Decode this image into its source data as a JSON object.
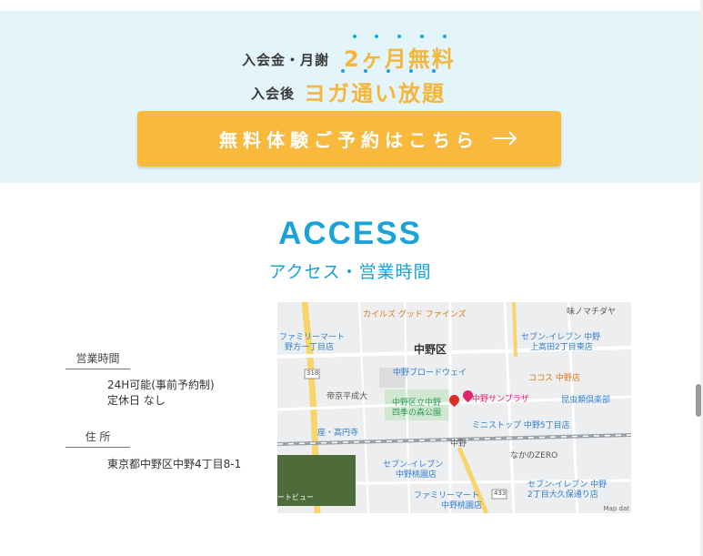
{
  "promo": {
    "line1_prefix": "入会金・月謝",
    "line1_highlight": "2ヶ月無料",
    "line2_prefix": "入会後",
    "line2_highlight": "ヨガ通い放題",
    "cta_label": "無料体験ご予約はこちら",
    "cta_arrow": "arrow-right-icon"
  },
  "access": {
    "title": "ACCESS",
    "subtitle": "アクセス・営業時間"
  },
  "info": {
    "hours_heading": "営業時間",
    "hours_line1": "24H可能(事前予約制)",
    "hours_line2": "定休日 なし",
    "address_heading": "住 所",
    "address": "東京都中野区中野4丁目8-1"
  },
  "map": {
    "labels": {
      "guitar": "カイルズ グッド ファインズ",
      "ajinomachi": "味ノマチダヤ",
      "familymart1_a": "ファミリーマート",
      "familymart1_b": "野方一丁目店",
      "seven1_a": "セブン-イレブン 中野",
      "seven1_b": "上高田2丁目東店",
      "nakano_ku": "中野区",
      "broadway": "中野ブロードウェイ",
      "cocos": "ココス 中野店",
      "teikyo": "帝京平成大",
      "park_a": "中野区立中野",
      "park_b": "四季の森公園",
      "sunplaza": "中野サンプラザ",
      "kochu": "昆虫類倶楽部",
      "koenji": "座・高円寺",
      "ministop": "ミニストップ 中野5丁目店",
      "nakano_zero": "なかのZERO",
      "nakano_station": "中野",
      "seven2_a": "セブン-イレブン",
      "seven2_b": "中野桃園店",
      "seven3_a": "セブン-イレブン 中野",
      "seven3_b": "2丁目大久保通り店",
      "familymart2_a": "ファミリーマート",
      "familymart2_b": "中野桃園店",
      "route_318": "318",
      "route_433": "433",
      "streetview": "ートビュー",
      "map_data": "Map dat"
    }
  },
  "colors": {
    "accent_blue": "#1aa3d9",
    "accent_orange": "#f8b93d",
    "promo_bg": "#e3f4fa"
  }
}
